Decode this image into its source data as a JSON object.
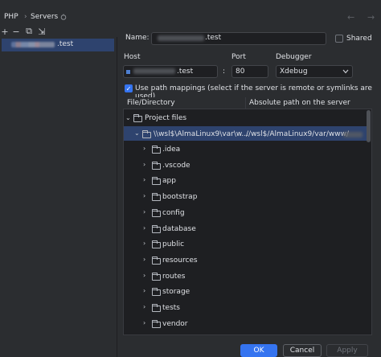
{
  "breadcrumb": {
    "root": "PHP",
    "separator": "›",
    "current": "Servers"
  },
  "toolbar": {
    "add": "+",
    "remove": "−",
    "copy": "⧉",
    "import": "⇲"
  },
  "servers": [
    {
      "name_suffix": ".test"
    }
  ],
  "form": {
    "name_label": "Name:",
    "name_suffix": ".test",
    "shared_label": "Shared",
    "host_label": "Host",
    "host_suffix": ".test",
    "port_label": "Port",
    "port_value": "80",
    "colon": ":",
    "debugger_label": "Debugger",
    "debugger_value": "Xdebug",
    "path_mappings_label": "Use path mappings (select if the server is remote or symlinks are used)"
  },
  "table": {
    "col_local": "File/Directory",
    "col_remote": "Absolute path on the server",
    "root": "Project files",
    "mapping_local": "\\\\wsl$\\AlmaLinux9\\var\\w...",
    "mapping_remote": "//wsl$/AlmaLinux9/var/www/",
    "children": [
      ".idea",
      ".vscode",
      "app",
      "bootstrap",
      "config",
      "database",
      "public",
      "resources",
      "routes",
      "storage",
      "tests",
      "vendor"
    ]
  },
  "buttons": {
    "ok": "OK",
    "cancel": "Cancel",
    "apply": "Apply"
  },
  "colors": {
    "accent": "#3574f0",
    "selection": "#2e436e",
    "background": "#2b2d30",
    "field": "#1e1f22"
  }
}
